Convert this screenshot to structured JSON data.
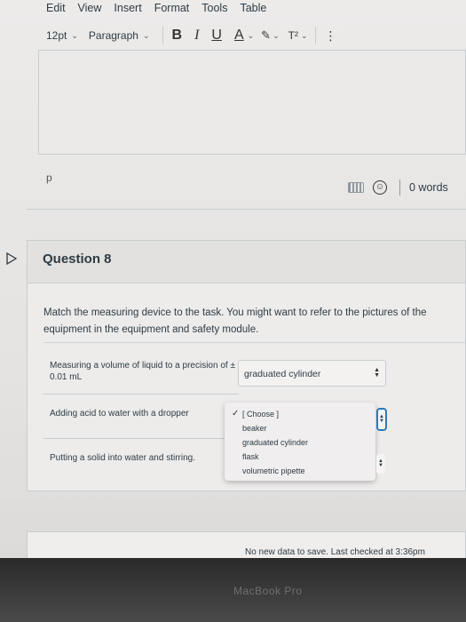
{
  "menubar": {
    "items": [
      "Edit",
      "View",
      "Insert",
      "Format",
      "Tools",
      "Table"
    ]
  },
  "toolbar": {
    "font_size": "12pt",
    "block_format": "Paragraph",
    "bold": "B",
    "italic": "I",
    "underline": "U",
    "text_color": "A",
    "superscript": "T²",
    "more": "⋮"
  },
  "editor": {
    "path_tag": "p",
    "word_count": "0 words"
  },
  "question": {
    "title": "Question 8",
    "prompt": "Match the measuring device to the task. You might want to refer to the pictures of the equipment in the equipment and safety module.",
    "rows": [
      {
        "label": "Measuring a volume of liquid to a precision of ± 0.01 mL",
        "selected": "graduated cylinder"
      },
      {
        "label": "Adding acid to water with a dropper",
        "selected": "[ Choose ]"
      },
      {
        "label": "Putting a solid into water and stirring.",
        "selected": ""
      }
    ],
    "options": [
      "[ Choose ]",
      "beaker",
      "graduated cylinder",
      "flask",
      "volumetric pipette"
    ]
  },
  "footer": {
    "status": "No new data to save. Last checked at 3:36pm"
  },
  "device": {
    "brand": "MacBook Pro"
  }
}
